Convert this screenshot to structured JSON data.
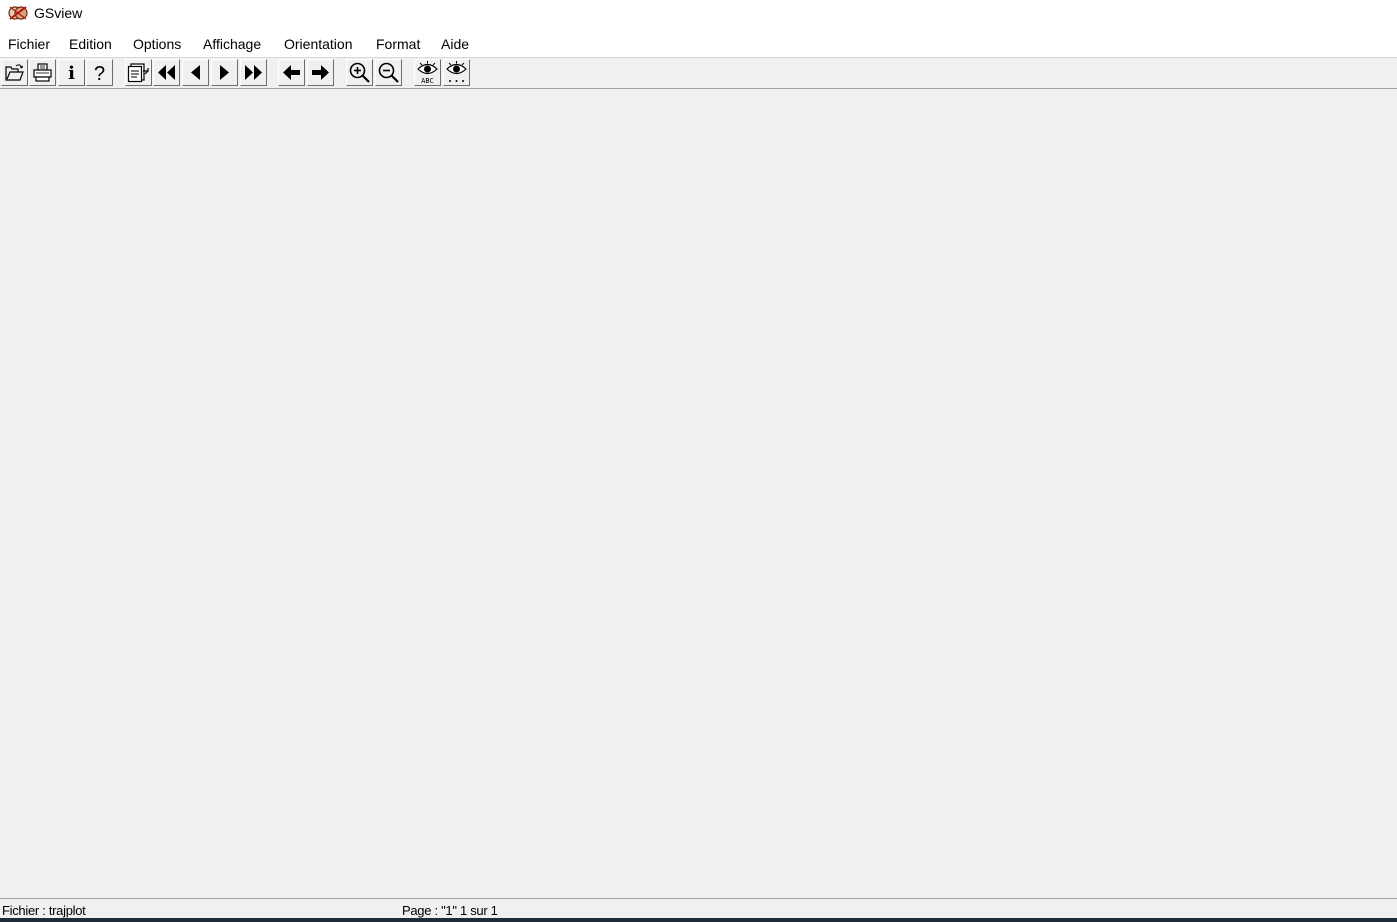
{
  "window": {
    "title": "GSview",
    "app_icon": "gsview-logo-icon"
  },
  "menu": {
    "items": [
      {
        "label": "Fichier"
      },
      {
        "label": "Edition"
      },
      {
        "label": "Options"
      },
      {
        "label": "Affichage"
      },
      {
        "label": "Orientation"
      },
      {
        "label": "Format"
      },
      {
        "label": "Aide"
      }
    ]
  },
  "toolbar": {
    "buttons": [
      {
        "icon": "open-folder-icon"
      },
      {
        "icon": "printer-icon"
      },
      {
        "icon": "info-icon",
        "glyph": "i"
      },
      {
        "icon": "help-icon",
        "glyph": "?"
      },
      {
        "icon": "goto-page-icon"
      },
      {
        "icon": "first-page-icon"
      },
      {
        "icon": "previous-page-icon"
      },
      {
        "icon": "next-page-icon"
      },
      {
        "icon": "last-page-icon"
      },
      {
        "icon": "back-arrow-icon"
      },
      {
        "icon": "forward-arrow-icon"
      },
      {
        "icon": "zoom-in-icon"
      },
      {
        "icon": "zoom-out-icon"
      },
      {
        "icon": "eye-abc-icon",
        "glyph": "ABC"
      },
      {
        "icon": "eye-dots-icon"
      }
    ]
  },
  "status": {
    "file": "Fichier : trajplot",
    "page": "Page : \"1\"  1 sur 1"
  }
}
